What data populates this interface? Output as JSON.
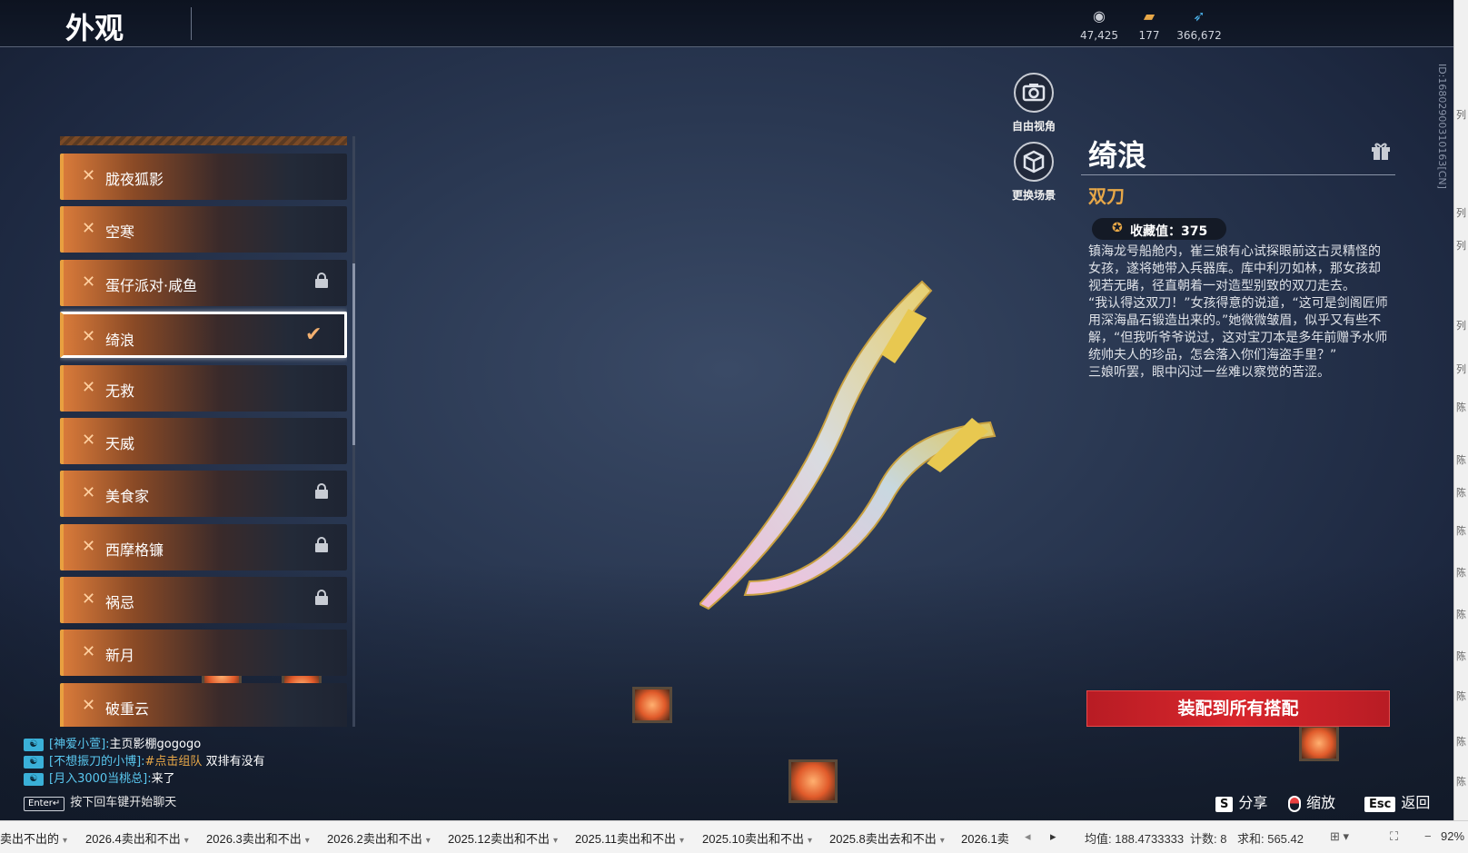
{
  "header": {
    "title": "外观",
    "currencies": [
      {
        "icon": "silver-coin-icon",
        "value": "47,425"
      },
      {
        "icon": "gold-ticket-icon",
        "value": "177"
      },
      {
        "icon": "feather-icon",
        "value": "366,672"
      }
    ]
  },
  "skins": [
    {
      "name": "胧夜狐影",
      "locked": false,
      "selected": false
    },
    {
      "name": "空寒",
      "locked": false,
      "selected": false
    },
    {
      "name": "蛋仔派对·咸鱼",
      "locked": true,
      "selected": false
    },
    {
      "name": "绮浪",
      "locked": false,
      "selected": true
    },
    {
      "name": "无救",
      "locked": false,
      "selected": false
    },
    {
      "name": "天威",
      "locked": false,
      "selected": false
    },
    {
      "name": "美食家",
      "locked": true,
      "selected": false
    },
    {
      "name": "西摩格镰",
      "locked": true,
      "selected": false
    },
    {
      "name": "祸忌",
      "locked": true,
      "selected": false
    },
    {
      "name": "新月",
      "locked": false,
      "selected": false
    },
    {
      "name": "破重云",
      "locked": false,
      "selected": false
    }
  ],
  "camera": {
    "free_view_label": "自由视角",
    "change_scene_label": "更换场景"
  },
  "detail": {
    "name": "绮浪",
    "type": "双刀",
    "collect_label": "收藏值：375",
    "description": "镇海龙号船舱内，崔三娘有心试探眼前这古灵精怪的女孩，遂将她带入兵器库。库中利刃如林，那女孩却视若无睹，径直朝着一对造型别致的双刀走去。\n“我认得这双刀！”女孩得意的说道，“这可是剑阁匠师用深海晶石锻造出来的。”她微微皱眉，似乎又有些不解，“但我听爷爷说过，这对宝刀本是多年前赠予水师统帅夫人的珍品，怎会落入你们海盗手里？”\n三娘听罢，眼中闪过一丝难以察觉的苦涩。",
    "equip_button": "装配到所有搭配"
  },
  "watermark": "ID:1680290031016​3[CN]",
  "chat": [
    {
      "user": "[神爱小萱]:",
      "text": "主页影棚gogogo",
      "highlight": ""
    },
    {
      "user": "[不想振刀的小博]:",
      "text": "双排有没有",
      "highlight": "#点击组队"
    },
    {
      "user": "[月入3000当桃总]:",
      "text": "来了",
      "highlight": ""
    }
  ],
  "chat_hint": {
    "key": "Enter↵",
    "text": "按下回车键开始聊天"
  },
  "hotkeys": [
    {
      "key": "S",
      "label": "分享"
    },
    {
      "key": "",
      "label": "缩放"
    },
    {
      "key": "Esc",
      "label": "返回"
    }
  ],
  "sheet": {
    "tabs": [
      "卖出不出的",
      "2026.4卖出和不出",
      "2026.3卖出和不出",
      "2026.2卖出和不出",
      "2025.12卖出和不出",
      "2025.11卖出和不出",
      "2025.10卖出和不出",
      "2025.8卖出去和不出",
      "2026.1卖"
    ],
    "stats": {
      "average": "均值: 188.4733333",
      "count": "计数: 8",
      "sum": "求和: 565.42",
      "zoom": "92%"
    }
  },
  "right_edge_chars": [
    "列",
    "列",
    "列",
    "列",
    "列",
    "陈",
    "陈",
    "陈",
    "陈",
    "陈",
    "陈",
    "陈",
    "陈",
    "陈",
    "陈"
  ]
}
